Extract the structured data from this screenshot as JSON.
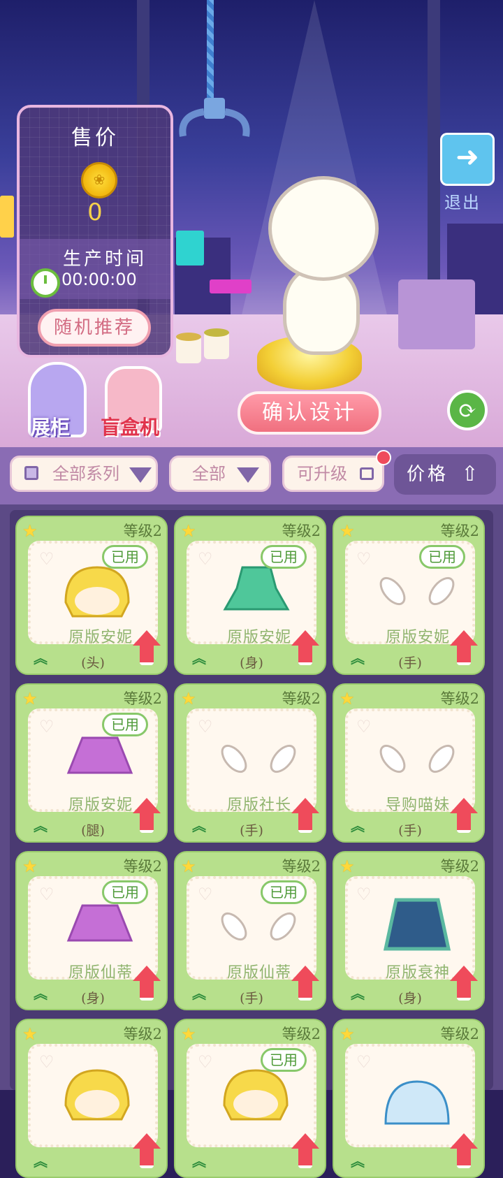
{
  "price_panel": {
    "title": "售价",
    "price": "0",
    "time_label": "生产时间",
    "time_value": "00:00:00",
    "random_btn": "随机推荐"
  },
  "exit_label": "退出",
  "showcase_label": "展柜",
  "blindbox_label": "盲盒机",
  "confirm_label": "确认设计",
  "filters": {
    "series": "全部系列",
    "type": "全部",
    "upgradable": "可升级",
    "price": "价格"
  },
  "colors": {
    "card_bg": "#b7e08c",
    "accent_pink": "#f0707f",
    "panel_purple": "#6e5597"
  },
  "cards": [
    {
      "level": "等级2",
      "name": "原版安妮",
      "slot": "(头)",
      "used": "已用",
      "icon": "hair-item-icon"
    },
    {
      "level": "等级2",
      "name": "原版安妮",
      "slot": "(身)",
      "used": "已用",
      "icon": "dress-item-icon"
    },
    {
      "level": "等级2",
      "name": "原版安妮",
      "slot": "(手)",
      "used": "已用",
      "icon": "hands-item-icon"
    },
    {
      "level": "等级2",
      "name": "原版安妮",
      "slot": "(腿)",
      "used": "已用",
      "icon": "skirt-item-icon"
    },
    {
      "level": "等级2",
      "name": "原版社长",
      "slot": "(手)",
      "used": "",
      "icon": "hands-item-icon"
    },
    {
      "level": "等级2",
      "name": "导购喵妹",
      "slot": "(手)",
      "used": "",
      "icon": "hands-item-icon"
    },
    {
      "level": "等级2",
      "name": "原版仙蒂",
      "slot": "(身)",
      "used": "已用",
      "icon": "skirt-item-icon"
    },
    {
      "level": "等级2",
      "name": "原版仙蒂",
      "slot": "(手)",
      "used": "已用",
      "icon": "hands-item-icon"
    },
    {
      "level": "等级2",
      "name": "原版衰神",
      "slot": "(身)",
      "used": "",
      "icon": "coat-item-icon"
    },
    {
      "level": "等级2",
      "name": "",
      "slot": "",
      "used": "",
      "icon": "hair-item-icon"
    },
    {
      "level": "等级2",
      "name": "",
      "slot": "",
      "used": "已用",
      "icon": "hair-item-icon"
    },
    {
      "level": "等级2",
      "name": "",
      "slot": "",
      "used": "",
      "icon": "hat-item-icon"
    }
  ]
}
